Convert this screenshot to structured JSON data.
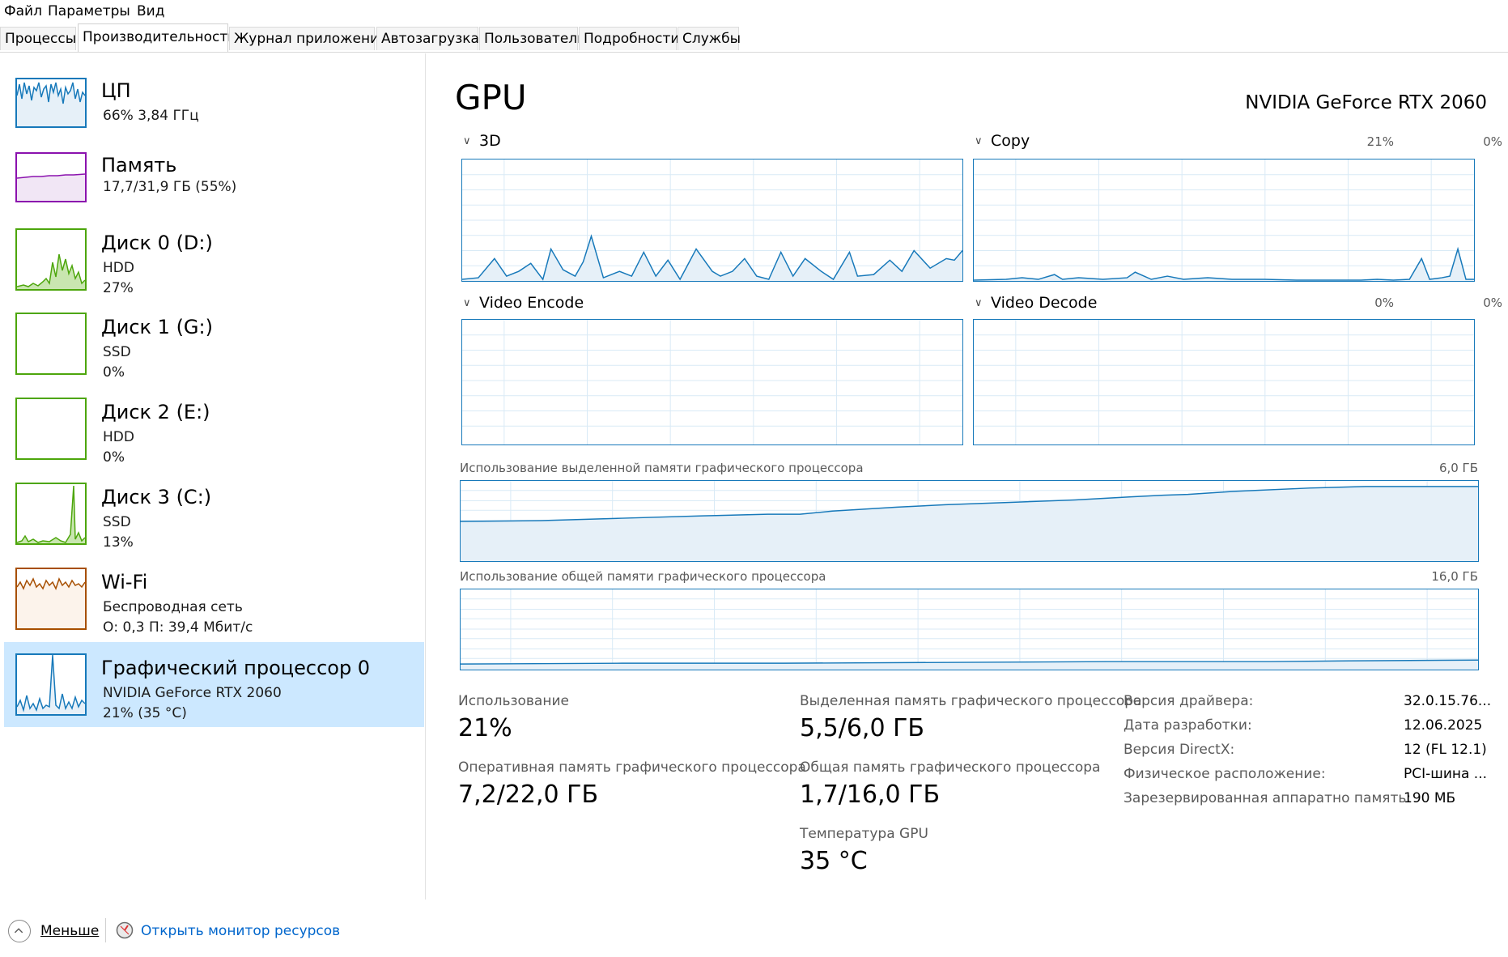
{
  "menu": {
    "file": "Файл",
    "params": "Параметры",
    "view": "Вид"
  },
  "tabs": [
    "Процессы",
    "Производительность",
    "Журнал приложений",
    "Автозагрузка",
    "Пользователи",
    "Подробности",
    "Службы"
  ],
  "sidebar": {
    "items": [
      {
        "title": "ЦП",
        "lines": [
          "66%  3,84 ГГц"
        ],
        "icon": "cpu-graph",
        "color": "#1779ba",
        "fill": "#e6f0f8"
      },
      {
        "title": "Память",
        "lines": [
          "17,7/31,9 ГБ (55%)"
        ],
        "icon": "memory-graph",
        "color": "#8b12ae",
        "fill": "#f1e6f5"
      },
      {
        "title": "Диск 0 (D:)",
        "lines": [
          "HDD",
          "27%"
        ],
        "icon": "disk-graph",
        "color": "#4da60c",
        "fill": "#eaf5e1"
      },
      {
        "title": "Диск 1 (G:)",
        "lines": [
          "SSD",
          "0%"
        ],
        "icon": "disk-graph",
        "color": "#4da60c",
        "fill": "#eaf5e1"
      },
      {
        "title": "Диск 2 (E:)",
        "lines": [
          "HDD",
          "0%"
        ],
        "icon": "disk-graph",
        "color": "#4da60c",
        "fill": "#eaf5e1"
      },
      {
        "title": "Диск 3 (C:)",
        "lines": [
          "SSD",
          "13%"
        ],
        "icon": "disk-graph",
        "color": "#4da60c",
        "fill": "#eaf5e1"
      },
      {
        "title": "Wi-Fi",
        "lines": [
          "Беспроводная сеть",
          "О:  0,3  П:  39,4 Мбит/с"
        ],
        "icon": "network-graph",
        "color": "#a74f01",
        "fill": "#fcf3eb"
      },
      {
        "title": "Графический процессор 0",
        "lines": [
          "NVIDIA GeForce RTX 2060",
          "21% (35 °C)"
        ],
        "icon": "gpu-graph",
        "color": "#1779ba",
        "fill": "#e6f0f8",
        "selected": true
      }
    ]
  },
  "main": {
    "title": "GPU",
    "gpu_name": "NVIDIA GeForce RTX 2060",
    "engines": [
      {
        "label": "3D",
        "pct": "21%"
      },
      {
        "label": "Copy",
        "pct": "0%"
      },
      {
        "label": "Video Encode",
        "pct": "0%"
      },
      {
        "label": "Video Decode",
        "pct": "0%"
      }
    ],
    "dedicated_label": "Использование выделенной памяти графического процессора",
    "dedicated_max": "6,0 ГБ",
    "shared_label": "Использование общей памяти графического процессора",
    "shared_max": "16,0 ГБ",
    "stats": {
      "usage_label": "Использование",
      "usage_value": "21%",
      "dedicated_label": "Выделенная память графического процессора",
      "dedicated_value": "5,5/6,0 ГБ",
      "gpu_ram_label": "Оперативная память графического процессора",
      "gpu_ram_value": "7,2/22,0 ГБ",
      "shared_label": "Общая память графического процессора",
      "shared_value": "1,7/16,0 ГБ",
      "temp_label": "Температура GPU",
      "temp_value": "35 °C"
    },
    "info": [
      {
        "key": "Версия драйвера:",
        "value": "32.0.15.76..."
      },
      {
        "key": "Дата разработки:",
        "value": "12.06.2025"
      },
      {
        "key": "Версия DirectX:",
        "value": "12 (FL 12.1)"
      },
      {
        "key": "Физическое расположение:",
        "value": "PCI-шина ..."
      },
      {
        "key": "Зарезервированная аппаратно память:",
        "value": "190 МБ"
      }
    ]
  },
  "footer": {
    "less": "Меньше",
    "resmon": "Открыть монитор ресурсов"
  },
  "colors": {
    "accent": "#1779ba",
    "selected_bg": "#cce8ff",
    "link": "#0066cc"
  }
}
